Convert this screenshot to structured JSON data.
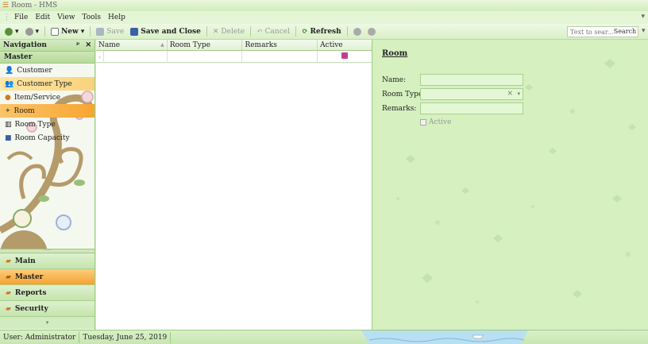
{
  "window": {
    "title": "Room - HMS"
  },
  "menu": [
    "File",
    "Edit",
    "View",
    "Tools",
    "Help"
  ],
  "toolbar": {
    "new_label": "New",
    "save_label": "Save",
    "save_close_label": "Save and Close",
    "delete_label": "Delete",
    "cancel_label": "Cancel",
    "refresh_label": "Refresh",
    "search_placeholder": "Text to sear...",
    "search_button": "Search"
  },
  "navigation": {
    "header": "Navigation",
    "pin": "ᵖ",
    "close": "✕",
    "group_title": "Master",
    "items": [
      "Customer",
      "Customer Type",
      "Item/Service",
      "Room",
      "Room Type",
      "Room Capacity"
    ],
    "selected_item": "Room",
    "hovered_item": "Customer Type",
    "groups": [
      "Main",
      "Master",
      "Reports",
      "Security"
    ],
    "active_group": "Master"
  },
  "grid": {
    "columns": [
      "Name",
      "Room Type",
      "Remarks",
      "Active"
    ]
  },
  "detail": {
    "title": "Room",
    "fields": [
      {
        "label": "Name:",
        "value": ""
      },
      {
        "label": "Room Type:",
        "value": ""
      },
      {
        "label": "Remarks:",
        "value": ""
      }
    ],
    "active_label": "Active"
  },
  "status": {
    "user": "User: Administrator",
    "date": "Tuesday, June 25, 2019"
  },
  "colors": {
    "accent_orange": "#f7a531",
    "background_green": "#d6f0c0",
    "highlight_yellow": "#fad27a"
  }
}
